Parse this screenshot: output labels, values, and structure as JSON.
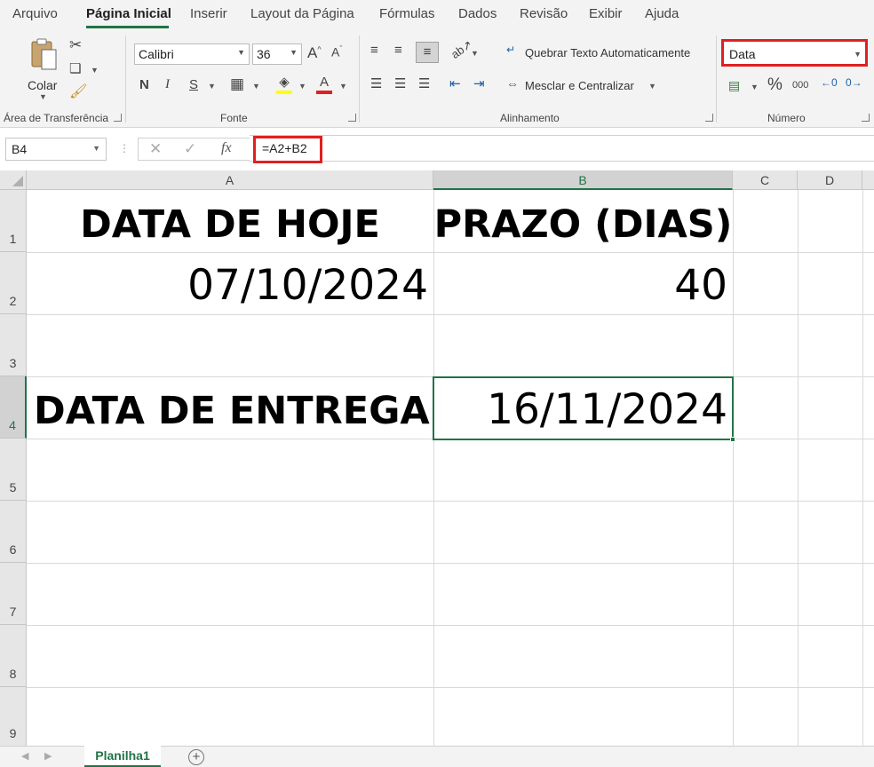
{
  "menu": {
    "tabs": [
      "Arquivo",
      "Página Inicial",
      "Inserir",
      "Layout da Página",
      "Fórmulas",
      "Dados",
      "Revisão",
      "Exibir",
      "Ajuda"
    ]
  },
  "ribbon": {
    "clipboard": {
      "paste_label": "Colar",
      "group_label": "Área de Transferência"
    },
    "font": {
      "font_name": "Calibri",
      "font_size": "36",
      "bold": "N",
      "italic": "I",
      "underline": "S",
      "grow": "A^",
      "shrink": "Aˇ",
      "font_color_letter": "A",
      "group_label": "Fonte"
    },
    "alignment": {
      "wrap_text": "Quebrar Texto Automaticamente",
      "merge_center": "Mesclar e Centralizar",
      "group_label": "Alinhamento"
    },
    "number": {
      "format": "Data",
      "percent": "%",
      "thousands": "000",
      "group_label": "Número"
    }
  },
  "formula_bar": {
    "name_box": "B4",
    "formula": "=A2+B2",
    "fx": "fx"
  },
  "sheet": {
    "columns": [
      "A",
      "B",
      "C",
      "D"
    ],
    "rows": [
      "1",
      "2",
      "3",
      "4",
      "5",
      "6",
      "7",
      "8",
      "9"
    ],
    "cells": {
      "A1": "DATA DE HOJE",
      "B1": "PRAZO (DIAS)",
      "A2": "07/10/2024",
      "B2": "40",
      "A4": "DATA DE ENTREGA",
      "B4": "16/11/2024"
    },
    "active_cell": "B4"
  },
  "sheet_tabs": {
    "active": "Planilha1",
    "add": "+"
  },
  "colors": {
    "accent": "#217346",
    "highlight": "#e02020"
  }
}
